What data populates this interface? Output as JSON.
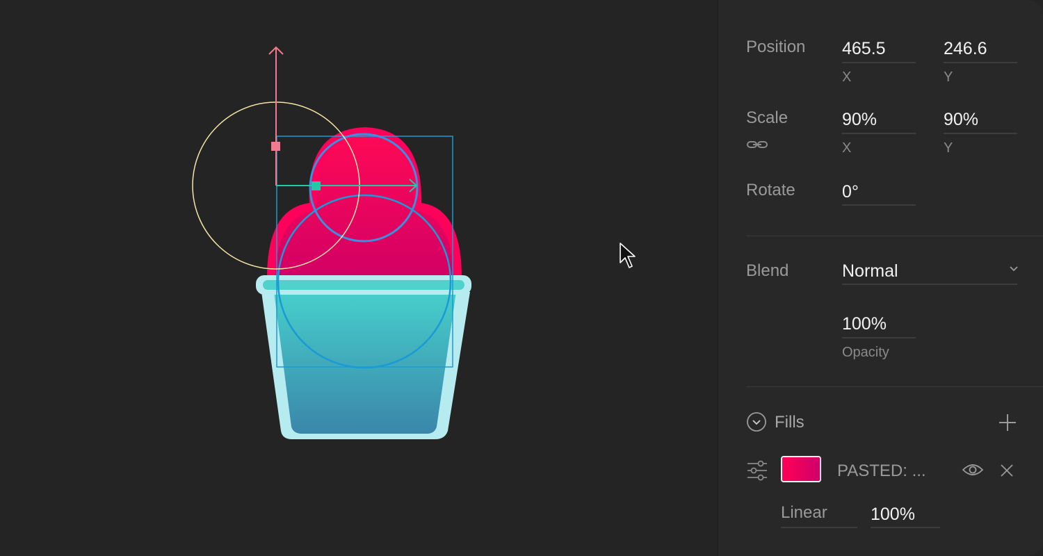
{
  "transform": {
    "position_label": "Position",
    "position_x": "465.5",
    "position_y": "246.6",
    "x_label": "X",
    "y_label": "Y",
    "scale_label": "Scale",
    "scale_x": "90%",
    "scale_y": "90%",
    "rotate_label": "Rotate",
    "rotate_value": "0°"
  },
  "appearance": {
    "blend_label": "Blend",
    "blend_value": "Normal",
    "opacity_value": "100%",
    "opacity_label": "Opacity"
  },
  "fills": {
    "title": "Fills",
    "items": [
      {
        "name": "PASTED: ...",
        "type": "Linear",
        "opacity": "100%",
        "gradient_colors": [
          "#ff0055",
          "#d0006a"
        ]
      }
    ]
  },
  "icons": {
    "link": "link-icon",
    "dropdown": "chevron-down-icon",
    "collapse": "chevron-circle-icon",
    "add": "plus-icon",
    "fill_settings": "sliders-icon",
    "visibility": "eye-icon",
    "remove": "close-icon",
    "cursor": "cursor-arrow-icon"
  },
  "colors": {
    "background": "#242424",
    "panel": "#282828",
    "selection": "#1a9ad6",
    "y_axis": "#f27a8f",
    "x_axis": "#23c9a6",
    "pivot_circle": "#f5e6a8",
    "cream_top": "#ff0a55",
    "cup": "#44c2c8",
    "cup_rim": "#b6ecef"
  }
}
